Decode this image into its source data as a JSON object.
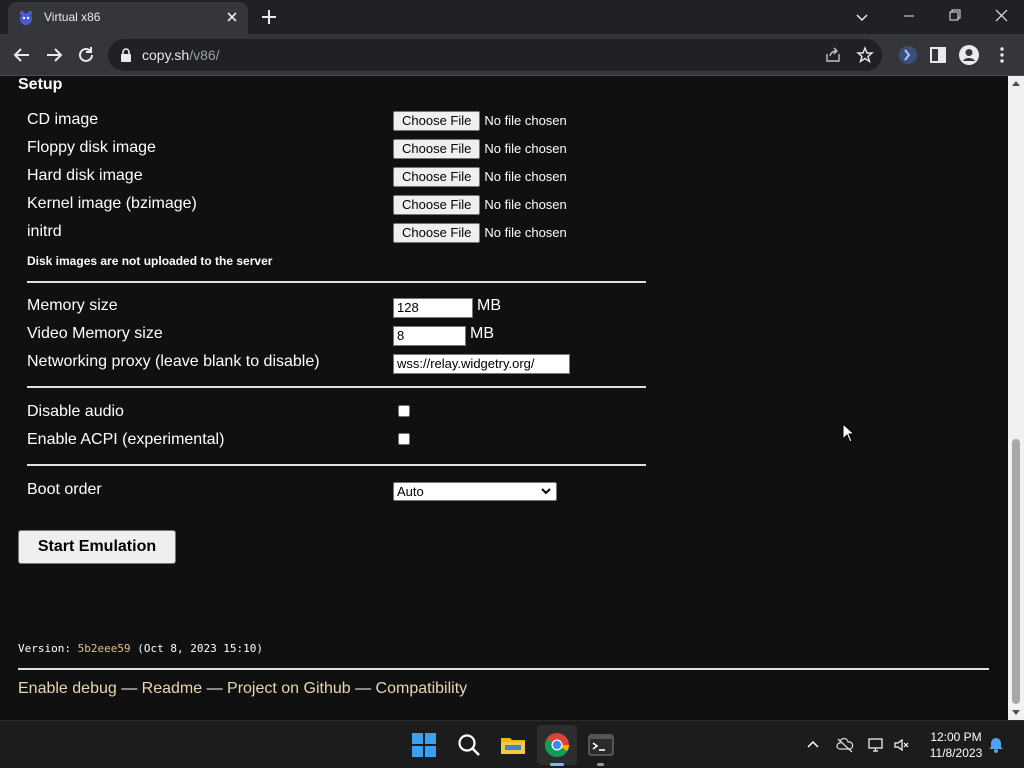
{
  "browser": {
    "tab_title": "Virtual x86",
    "url_host": "copy.sh",
    "url_path": "/v86/"
  },
  "setup": {
    "title": "Setup",
    "file_inputs": [
      {
        "label": "CD image",
        "button": "Choose File",
        "status": "No file chosen"
      },
      {
        "label": "Floppy disk image",
        "button": "Choose File",
        "status": "No file chosen"
      },
      {
        "label": "Hard disk image",
        "button": "Choose File",
        "status": "No file chosen"
      },
      {
        "label": "Kernel image (bzimage)",
        "button": "Choose File",
        "status": "No file chosen"
      },
      {
        "label": "initrd",
        "button": "Choose File",
        "status": "No file chosen"
      }
    ],
    "disk_note": "Disk images are not uploaded to the server",
    "memory_label": "Memory size",
    "memory_value": "128",
    "memory_unit": "MB",
    "video_memory_label": "Video Memory size",
    "video_memory_value": "8",
    "video_memory_unit": "MB",
    "proxy_label": "Networking proxy (leave blank to disable)",
    "proxy_value": "wss://relay.widgetry.org/",
    "disable_audio_label": "Disable audio",
    "disable_audio_checked": false,
    "acpi_label": "Enable ACPI (experimental)",
    "acpi_checked": false,
    "boot_order_label": "Boot order",
    "boot_order_value": "Auto",
    "start_button": "Start Emulation"
  },
  "version": {
    "prefix": "Version: ",
    "hash": "5b2eee59",
    "date": " (Oct 8, 2023 15:10)"
  },
  "footer": {
    "links": [
      "Enable debug",
      "Readme",
      "Project on Github",
      "Compatibility"
    ],
    "separator": " — "
  },
  "taskbar": {
    "time": "12:00 PM",
    "date": "11/8/2023"
  },
  "colors": {
    "page_bg": "#101010",
    "link": "#e8d7b0",
    "version_hash": "#e0c080"
  }
}
